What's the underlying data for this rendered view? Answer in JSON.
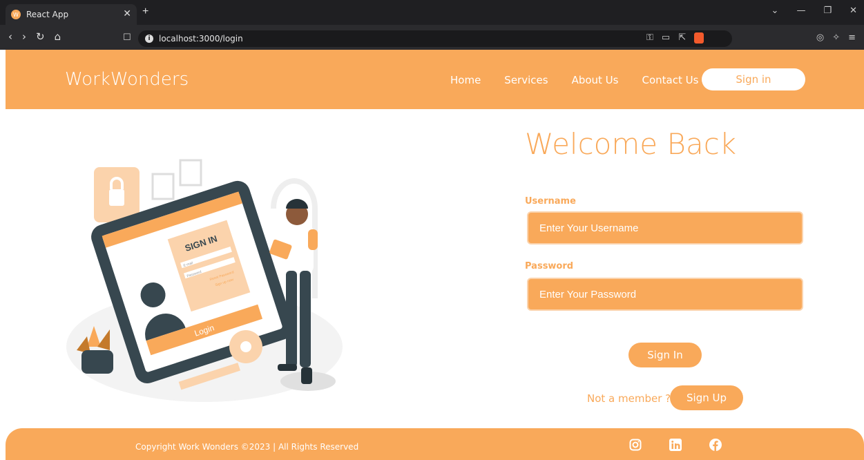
{
  "browser": {
    "tab_title": "React App",
    "tab_favicon": "W",
    "url": "localhost:3000/login"
  },
  "header": {
    "brand": "WorkWonders",
    "nav": [
      "Home",
      "Services",
      "About Us",
      "Contact Us"
    ],
    "signin_label": "Sign in"
  },
  "login": {
    "title": "Welcome Back",
    "username_label": "Username",
    "username_placeholder": "Enter Your Username",
    "password_label": "Password",
    "password_placeholder": "Enter Your Password",
    "signin_button": "Sign In",
    "not_member_text": "Not a member ?",
    "signup_button": "Sign Up"
  },
  "illustration": {
    "sign_in_text": "SIGN IN",
    "login_text": "Login",
    "email_text": "E-mail",
    "password_text": "Password",
    "reset_text": "Reset Password",
    "signup_text": "Sign up now"
  },
  "footer": {
    "copyright": "Copyright Work Wonders ©2023 | All Rights Reserved",
    "social": [
      "instagram-icon",
      "linkedin-icon",
      "facebook-icon"
    ]
  },
  "colors": {
    "accent": "#f9a95a",
    "white": "#ffffff",
    "dark": "#37474f"
  }
}
